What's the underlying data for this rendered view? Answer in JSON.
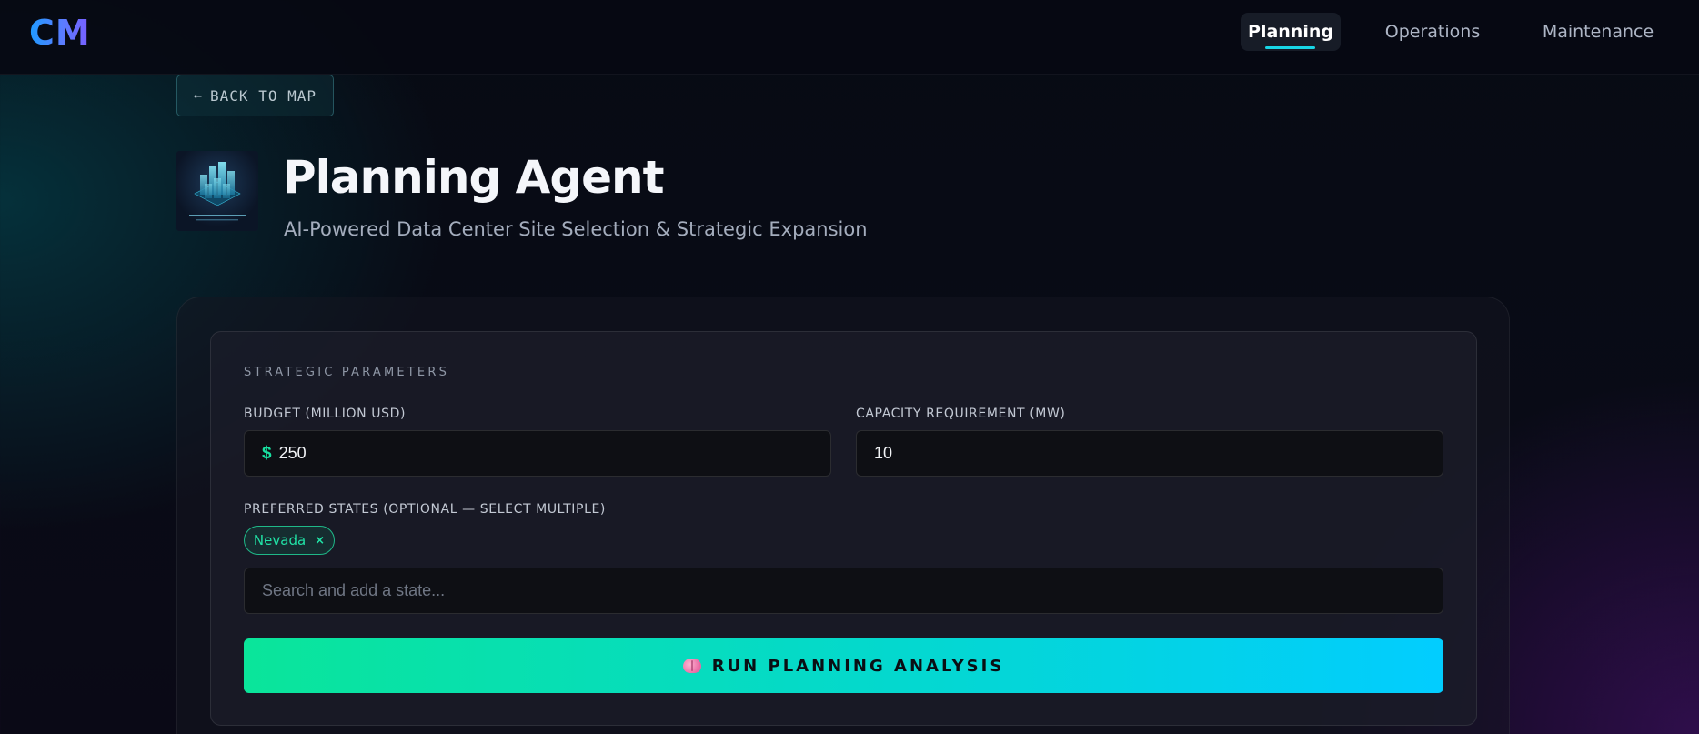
{
  "header": {
    "logo": "CM",
    "nav": [
      {
        "label": "Planning",
        "active": true
      },
      {
        "label": "Operations",
        "active": false
      },
      {
        "label": "Maintenance",
        "active": false
      }
    ]
  },
  "back_button": {
    "arrow": "←",
    "label": "BACK TO MAP"
  },
  "hero": {
    "image_icon": "data-center-network-image",
    "title": "Planning Agent",
    "subtitle": "AI-Powered Data Center Site Selection & Strategic Expansion"
  },
  "form": {
    "section_title": "STRATEGIC PARAMETERS",
    "budget": {
      "label": "BUDGET (MILLION USD)",
      "prefix": "$",
      "value": "250"
    },
    "capacity": {
      "label": "CAPACITY REQUIREMENT (MW)",
      "value": "10"
    },
    "states": {
      "label": "PREFERRED STATES (OPTIONAL — SELECT MULTIPLE)",
      "selected": [
        {
          "name": "Nevada",
          "remove": "×"
        }
      ],
      "placeholder": "Search and add a state..."
    },
    "run_button": {
      "icon": "brain-icon",
      "label": "RUN PLANNING ANALYSIS"
    }
  },
  "colors": {
    "accent_teal": "#18d6e6",
    "accent_green": "#21e3a6",
    "button_gradient_start": "#0ae59a",
    "button_gradient_end": "#02cdff"
  }
}
